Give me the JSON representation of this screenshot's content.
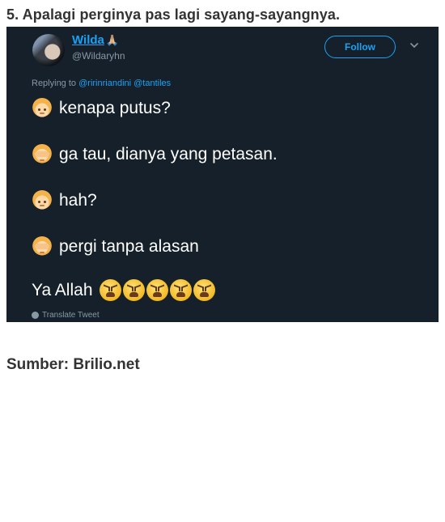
{
  "heading": "5. Apalagi perginya pas lagi sayang-sayangnya.",
  "tweet": {
    "name": "Wilda",
    "name_emoji": "🙏🏼",
    "handle": "@Wildaryhn",
    "follow_label": "Follow",
    "replying_prefix": "Replying to",
    "replying_mentions": "@ririnriandini @tantiles",
    "lines": [
      {
        "emoji": "person",
        "text": "kenapa putus?"
      },
      {
        "emoji": "hands",
        "text": "ga tau, dianya yang petasan."
      },
      {
        "emoji": "person",
        "text": "hah?"
      },
      {
        "emoji": "hands",
        "text": "pergi tanpa alasan"
      }
    ],
    "closing_text": "Ya Allah",
    "closing_emoji": "tired-face",
    "closing_emoji_count": 5,
    "translate_label": "Translate Tweet"
  },
  "source": "Sumber: Brilio.net",
  "colors": {
    "tweet_bg": "#15202b",
    "accent": "#1da1f2",
    "muted": "#8899a6"
  }
}
